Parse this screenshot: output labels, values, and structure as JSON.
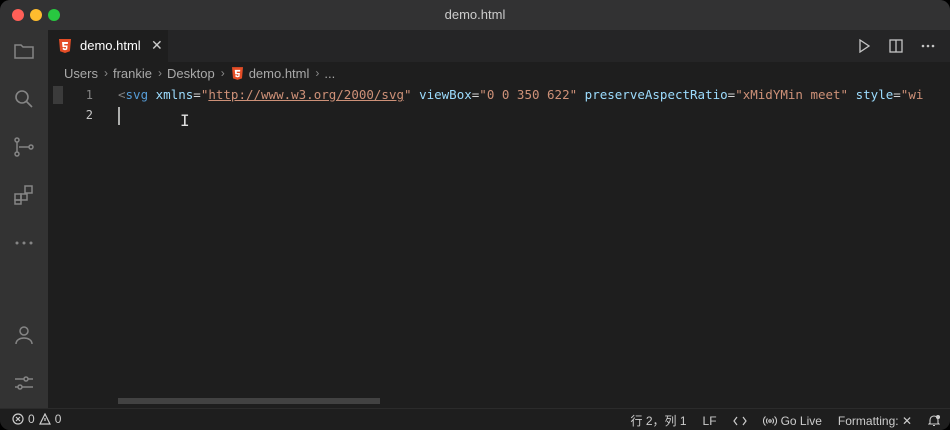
{
  "window": {
    "title": "demo.html"
  },
  "tab": {
    "label": "demo.html",
    "close": "✕"
  },
  "breadcrumbs": [
    "Users",
    "frankie",
    "Desktop",
    "demo.html",
    "..."
  ],
  "editor": {
    "line_numbers": [
      "1",
      "2"
    ],
    "line1": {
      "lt": "<",
      "tag": "svg",
      "a1": "xmlns",
      "eq1": "=",
      "q1o": "\"",
      "v1": "http://www.w3.org/2000/svg",
      "q1c": "\"",
      "a2": "viewBox",
      "eq2": "=",
      "v2": "\"0 0 350 622\"",
      "a3": "preserveAspectRatio",
      "eq3": "=",
      "v3": "\"xMidYMin meet\"",
      "a4": "style",
      "eq4": "=",
      "v4": "\"wi"
    },
    "line2": ""
  },
  "statusbar": {
    "errors": "0",
    "warnings": "0",
    "position": "行 2，列 1",
    "eol": "LF",
    "go_live": "Go Live",
    "formatting": "Formatting: ✕"
  },
  "colors": {
    "html_icon": "#e44d26",
    "accent": "#007acc"
  }
}
